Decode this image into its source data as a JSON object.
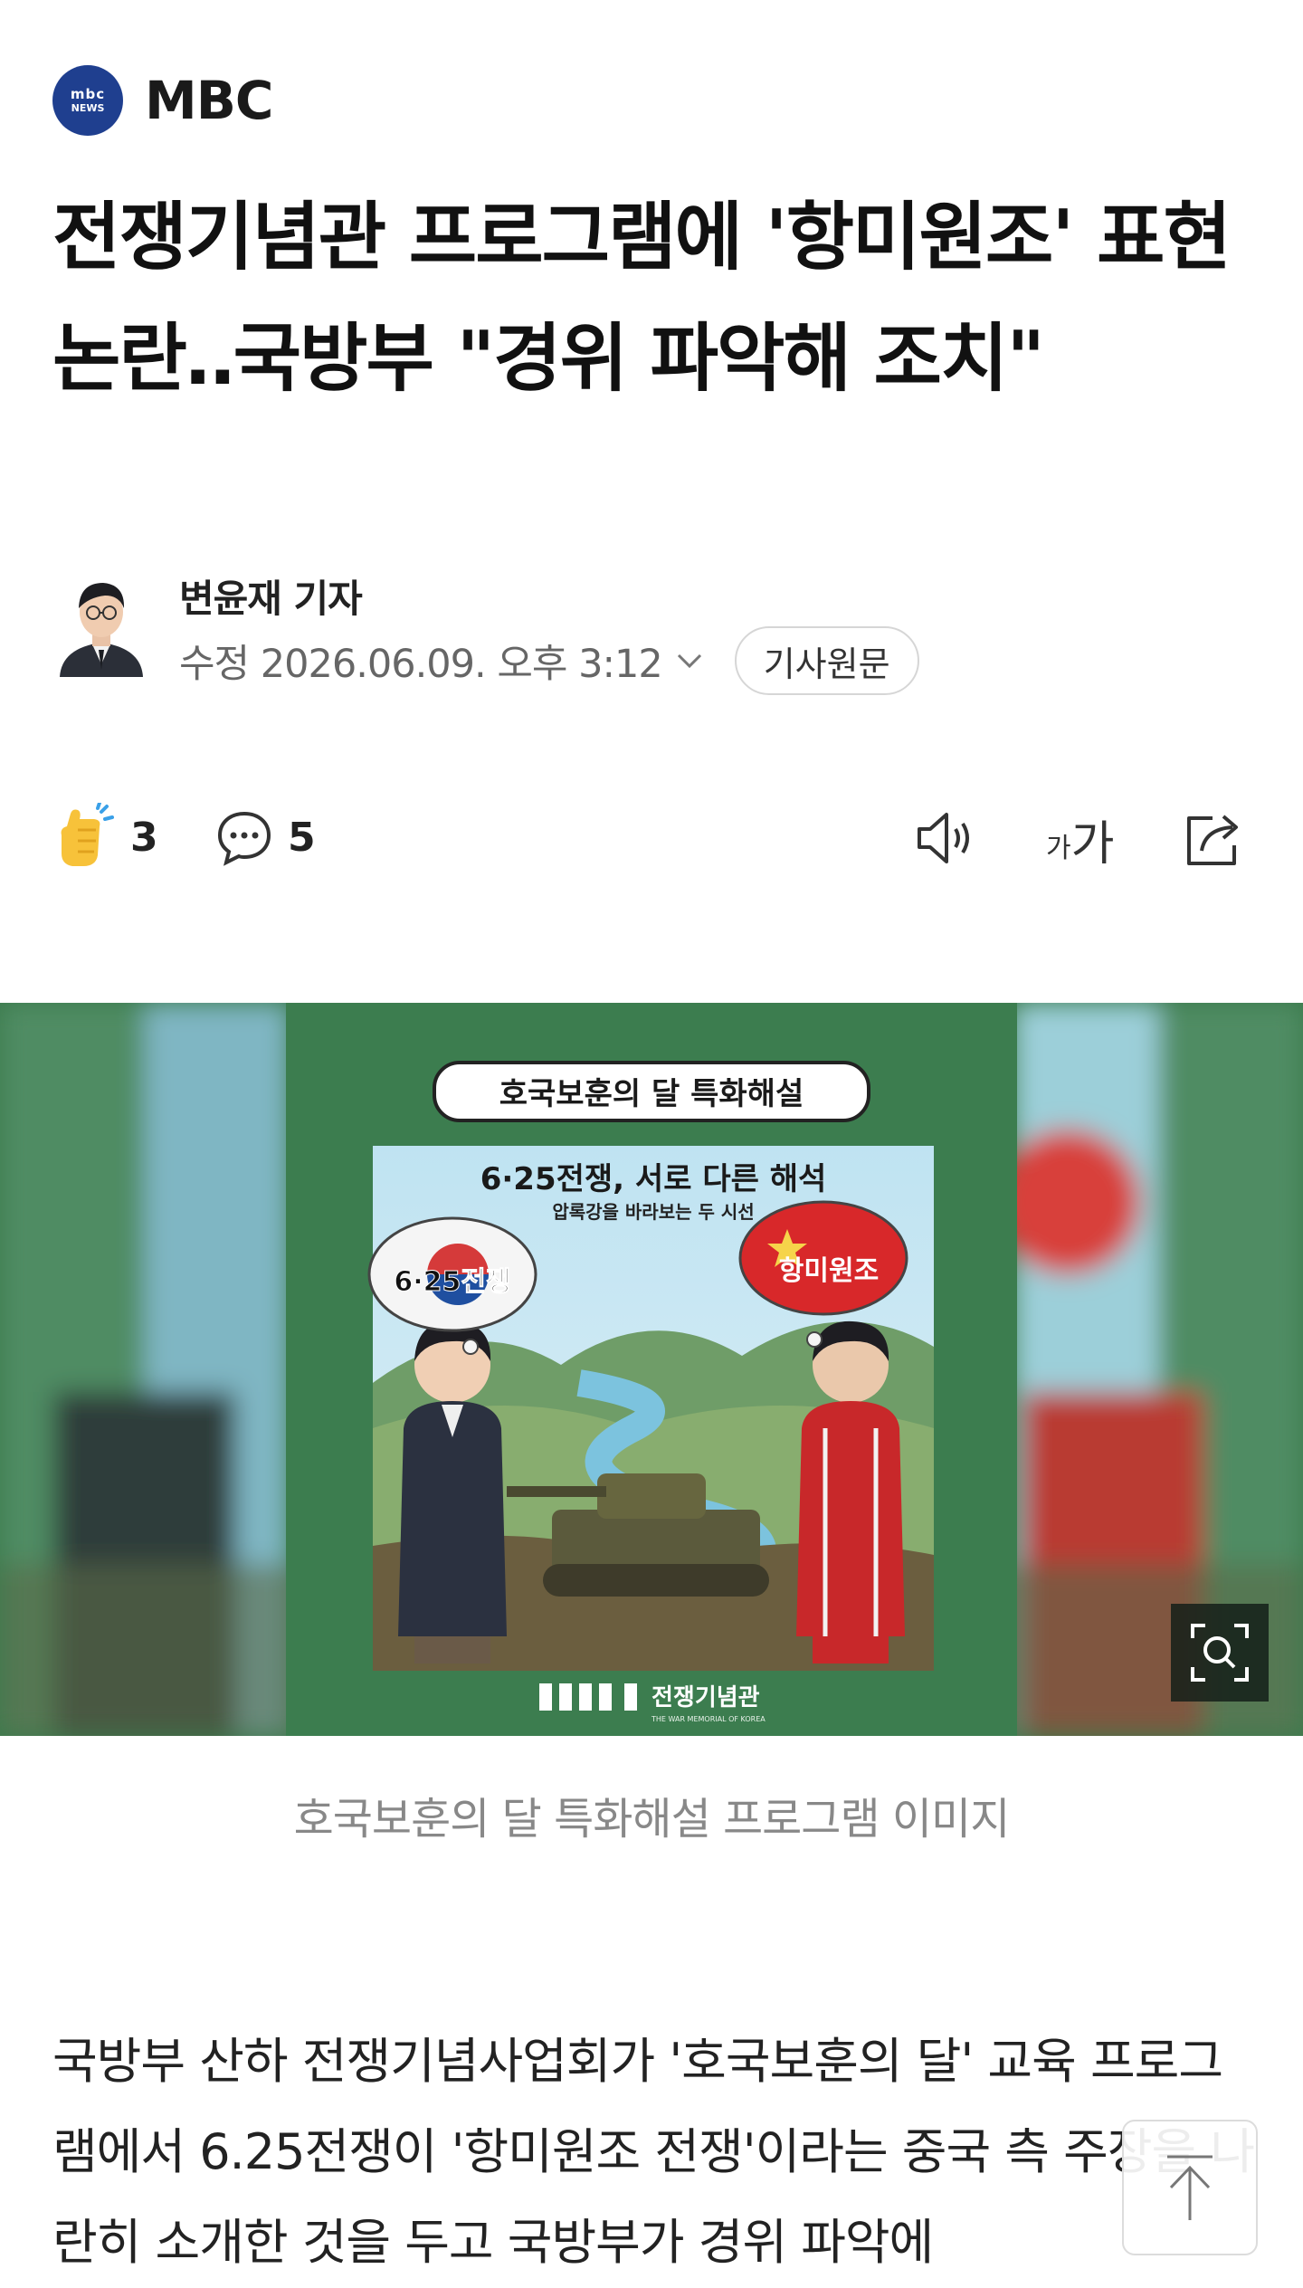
{
  "press": {
    "logo_line1": "mbc",
    "logo_line2": "NEWS",
    "name": "MBC",
    "logo_color": "#1f3f8f"
  },
  "article": {
    "headline": "전쟁기념관 프로그램에 '항미원조' 표현 논란‥국방부 \"경위 파악해 조치\"",
    "author": "변윤재 기자",
    "date": "수정 2026.06.09. 오후 3:12",
    "source_button": "기사원문",
    "reaction_count": "3",
    "comment_count": "5"
  },
  "toolbar": {
    "reaction_icon": "clap-hand-icon",
    "comment_icon": "speech-bubble-icon",
    "tts_icon": "speaker-icon",
    "font_size_label_small": "가",
    "font_size_label_large": "가",
    "share_icon": "share-icon"
  },
  "image": {
    "banner": "호국보훈의 달 특화해설",
    "title": "6·25전쟁, 서로 다른 해석",
    "subtitle": "압록강을 바라보는 두 시선",
    "left_bubble": "6·25전쟁",
    "right_bubble": "항미원조",
    "logo_text": "전쟁기념관",
    "logo_sub": "THE WAR MEMORIAL OF KOREA",
    "caption": "호국보훈의 달 특화해설 프로그램 이미지"
  },
  "body": {
    "paragraph": "국방부 산하 전쟁기념사업회가 '호국보훈의 달' 교육 프로그램에서 6.25전쟁이 '항미원조 전쟁'이라는 중국 측 주장을 나란히 소개한 것을 두고 국방부가 경위 파악에"
  }
}
